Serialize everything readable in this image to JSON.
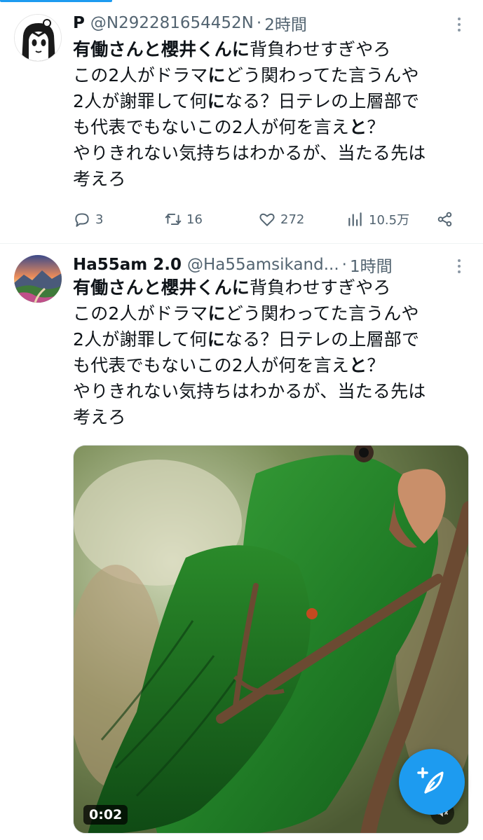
{
  "tweets": [
    {
      "display_name": "P",
      "handle": "@N292281654452N",
      "time": "2時間",
      "body_lines": [
        [
          {
            "t": "有働さんと櫻井くんに",
            "b": true
          },
          {
            "t": "背負わせすぎやろ",
            "b": false
          }
        ],
        [
          {
            "t": "この2人がドラマ",
            "b": false
          },
          {
            "t": "に",
            "b": true
          },
          {
            "t": "どう関わってた言うんや",
            "b": false
          }
        ],
        [
          {
            "t": "2人が謝罪して何",
            "b": false
          },
          {
            "t": "に",
            "b": true
          },
          {
            "t": "なる？日テレの上層部で",
            "b": false
          }
        ],
        [
          {
            "t": "も代表でもないこの2人が何を言え",
            "b": false
          },
          {
            "t": "と",
            "b": true
          },
          {
            "t": "？",
            "b": false
          }
        ],
        [
          {
            "t": "やりきれない気持ちはわかるが、当たる先は",
            "b": false
          }
        ],
        [
          {
            "t": "考えろ",
            "b": false
          }
        ]
      ],
      "replies": "3",
      "retweets": "16",
      "likes": "272",
      "views": "10.5万"
    },
    {
      "display_name": "Ha55am 2.0",
      "handle": "@Ha55amsikand...",
      "time": "1時間",
      "body_lines": [
        [
          {
            "t": "有働さんと櫻井くんに",
            "b": true
          },
          {
            "t": "背負わせすぎやろ",
            "b": false
          }
        ],
        [
          {
            "t": "この2人がドラマ",
            "b": false
          },
          {
            "t": "に",
            "b": true
          },
          {
            "t": "どう関わってた言うんや",
            "b": false
          }
        ],
        [
          {
            "t": "2人が謝罪して何",
            "b": false
          },
          {
            "t": "に",
            "b": true
          },
          {
            "t": "なる？日テレの上層部で",
            "b": false
          }
        ],
        [
          {
            "t": "も代表でもないこの2人が何を言え",
            "b": false
          },
          {
            "t": "と",
            "b": true
          },
          {
            "t": "？",
            "b": false
          }
        ],
        [
          {
            "t": "やりきれない気持ちはわかるが、当たる先は",
            "b": false
          }
        ],
        [
          {
            "t": "考えろ",
            "b": false
          }
        ]
      ],
      "video_time": "0:02"
    }
  ],
  "colors": {
    "accent": "#1d9bf0",
    "secondary_text": "#536471",
    "primary_text": "#0f1419"
  },
  "icons": [
    "reply-icon",
    "retweet-icon",
    "like-icon",
    "views-icon",
    "share-icon",
    "more-icon",
    "mute-icon",
    "compose-icon"
  ]
}
